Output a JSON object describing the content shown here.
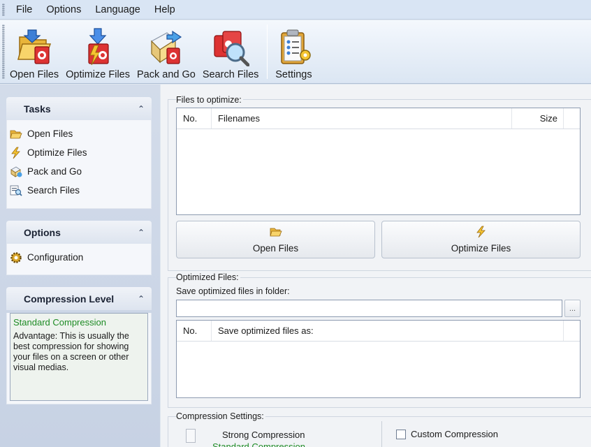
{
  "menu": [
    "File",
    "Options",
    "Language",
    "Help"
  ],
  "toolbar": {
    "open_files": "Open Files",
    "optimize_files": "Optimize Files",
    "pack_and_go": "Pack and Go",
    "search_files": "Search Files",
    "settings": "Settings"
  },
  "tasks_group": {
    "title": "Tasks",
    "items": [
      "Open Files",
      "Optimize Files",
      "Pack and Go",
      "Search Files"
    ]
  },
  "options_group": {
    "title": "Options",
    "items": [
      "Configuration"
    ]
  },
  "compression_group": {
    "title": "Compression Level",
    "level": "Standard Compression",
    "description": "Advantage: This is usually the best compression for showing your files on a screen or other visual medias."
  },
  "files_to_optimize": {
    "label": "Files to optimize:",
    "columns": [
      "No.",
      "Filenames",
      "Size"
    ],
    "rows": []
  },
  "buttons": {
    "open_files": "Open Files",
    "optimize_files": "Optimize Files",
    "browse": "..."
  },
  "optimized_files": {
    "label": "Optimized Files:",
    "folder_label": "Save optimized files in folder:",
    "folder_value": "",
    "columns": [
      "No.",
      "Save optimized files as:"
    ],
    "rows": []
  },
  "compression_settings": {
    "label": "Compression Settings:",
    "strong": "Strong Compression",
    "standard": "Standard Compression",
    "custom": "Custom Compression"
  },
  "colors": {
    "accent_green": "#1d8b24",
    "toolbar_bg": "#dbe6f3",
    "pane_bg": "#c7d2e4"
  }
}
